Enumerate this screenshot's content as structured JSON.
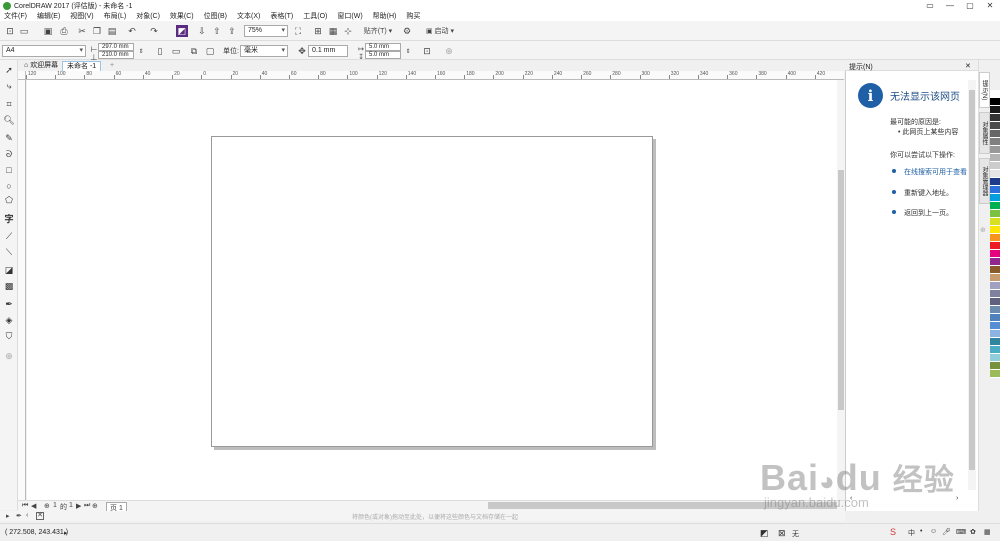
{
  "window": {
    "title": "CorelDRAW 2017 (评估版) - 未命名 -1",
    "buttons": [
      "▭",
      "—",
      "▢",
      "✕"
    ]
  },
  "menu": [
    "文件(F)",
    "编辑(E)",
    "视图(V)",
    "布局(L)",
    "对象(C)",
    "效果(C)",
    "位图(B)",
    "文本(X)",
    "表格(T)",
    "工具(O)",
    "窗口(W)",
    "帮助(H)",
    "购买"
  ],
  "toolbar": {
    "zoom": "75%",
    "snap_label": "贴齐(T)",
    "launch_label": "启动"
  },
  "propertybar": {
    "page_size": "A4",
    "width": "297.0 mm",
    "height": "210.0 mm",
    "units_label": "单位:",
    "units": "毫米",
    "nudge": "0.1 mm",
    "dup_x": "5.0 mm",
    "dup_y": "5.0 mm"
  },
  "tabs": {
    "welcome": "欢迎屏幕",
    "document": "未命名 -1",
    "add": "+"
  },
  "ruler": {
    "h_ticks": [
      "120",
      "100",
      "80",
      "60",
      "40",
      "20",
      "0",
      "20",
      "40",
      "60",
      "80",
      "100",
      "120",
      "140",
      "160",
      "180",
      "200",
      "220",
      "240",
      "260",
      "280",
      "300",
      "320",
      "340",
      "360",
      "380",
      "400",
      "420"
    ]
  },
  "pagenav": {
    "current": "1",
    "of": "的",
    "total": "1",
    "page_tab": "页 1"
  },
  "colorline_hint": "将颜色(或对象)拖动至此处，以便将这些颜色与文档存储在一起",
  "status": {
    "coords": "( 272.508, 243.431 )",
    "fill": "无"
  },
  "docker": {
    "title": "提示(N)",
    "heading": "无法显示该网页",
    "reason_label": "最可能的原因是:",
    "reason_1": "此网页上某些内容",
    "try_label": "你可以尝试以下操作:",
    "action_1": "在线搜索可用于查看",
    "action_2": "重新键入地址。",
    "action_3": "返回到上一页。",
    "side_tabs": [
      "提示(N)",
      "对象属性",
      "对象管理器"
    ]
  },
  "palette_colors": [
    "#ffffff",
    "#000000",
    "#1a1a1a",
    "#333333",
    "#4d4d4d",
    "#666666",
    "#808080",
    "#999999",
    "#b3b3b3",
    "#cccccc",
    "#e6e6e6",
    "#1e3a8a",
    "#2a6fdb",
    "#00a0e0",
    "#00b050",
    "#7cc242",
    "#d8e020",
    "#ffe600",
    "#f7941d",
    "#ed1c24",
    "#e6007e",
    "#92278f",
    "#8b5a2b",
    "#c69c6d",
    "#a0a0c0",
    "#8080a0",
    "#606080",
    "#6a8caf",
    "#4f81bd",
    "#558ed5",
    "#8db3e2",
    "#31859c",
    "#4bacc6",
    "#92cddc",
    "#76923c",
    "#9bbb59"
  ],
  "watermark": {
    "brand": "Bai",
    "brand2": "du",
    "cn": "经验",
    "url": "jingyan.baidu.com"
  }
}
